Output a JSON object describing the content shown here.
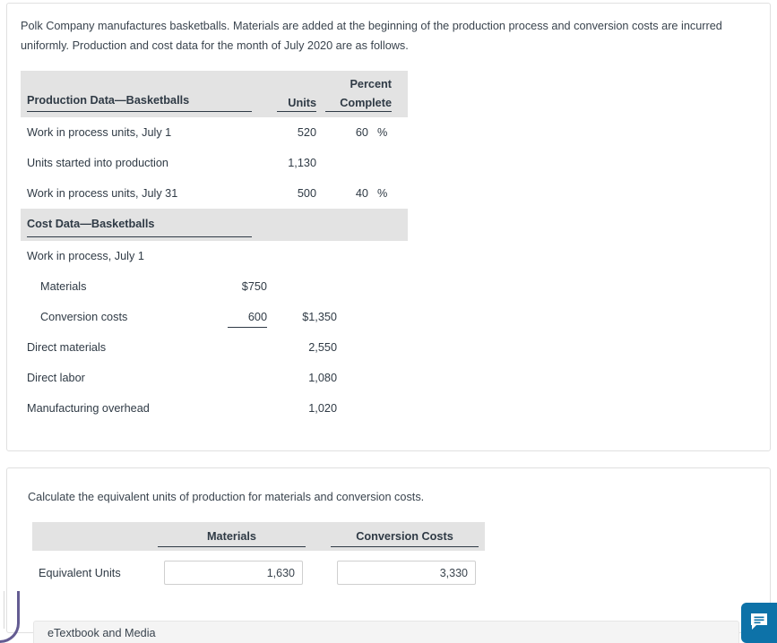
{
  "problem": {
    "intro": "Polk Company manufactures basketballs. Materials are added at the beginning of the production process and conversion costs are incurred uniformly. Production and cost data for the month of July 2020 are as follows.",
    "production_header": {
      "title": "Production Data—Basketballs",
      "units": "Units",
      "percent_line1": "Percent",
      "percent_line2": "Complete"
    },
    "production_rows": [
      {
        "label": "Work in process units, July 1",
        "units": "520",
        "percent": "60",
        "percent_symbol": "%"
      },
      {
        "label": "Units started into production",
        "units": "1,130",
        "percent": "",
        "percent_symbol": ""
      },
      {
        "label": "Work in process units, July 31",
        "units": "500",
        "percent": "40",
        "percent_symbol": "%"
      }
    ],
    "cost_header": {
      "title": "Cost Data—Basketballs"
    },
    "cost_rows": [
      {
        "label": "Work in process, July 1",
        "col1": "",
        "col2": "",
        "indent": false,
        "subtotal_rule": false
      },
      {
        "label": "Materials",
        "col1": "$750",
        "col2": "",
        "indent": true,
        "subtotal_rule": false
      },
      {
        "label": "Conversion costs",
        "col1": "600",
        "col2": "$1,350",
        "indent": true,
        "subtotal_rule": true
      },
      {
        "label": "Direct materials",
        "col1": "",
        "col2": "2,550",
        "indent": false,
        "subtotal_rule": false
      },
      {
        "label": "Direct labor",
        "col1": "",
        "col2": "1,080",
        "indent": false,
        "subtotal_rule": false
      },
      {
        "label": "Manufacturing overhead",
        "col1": "",
        "col2": "1,020",
        "indent": false,
        "subtotal_rule": false
      }
    ]
  },
  "answer": {
    "question": "Calculate the equivalent units of production for materials and conversion costs.",
    "columns": {
      "materials": "Materials",
      "conversion": "Conversion Costs"
    },
    "row_label": "Equivalent Units",
    "materials_value": "1,630",
    "conversion_value": "3,330",
    "input_placeholder": ""
  },
  "footer": {
    "etextbook_label": "eTextbook and Media"
  },
  "icons": {
    "feedback": "feedback-chat-icon"
  },
  "colors": {
    "band_gray": "#e3e3e3",
    "text": "#2f3a45",
    "feedback_blue": "#0d72a8",
    "card_border": "#e0e0e0"
  }
}
